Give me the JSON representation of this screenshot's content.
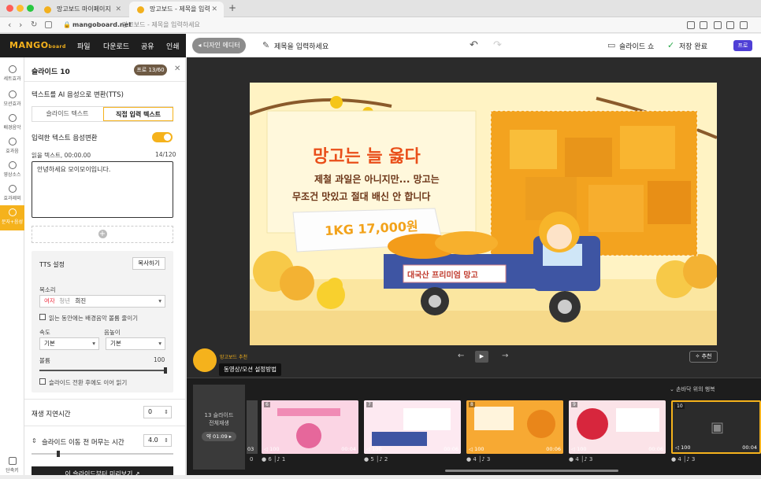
{
  "browser": {
    "tabs": [
      {
        "label": "망고보드 마이페이지"
      },
      {
        "label": "망고보드 - 제목을 입력하세요"
      }
    ],
    "url_domain": "mangoboard.net",
    "url_title": "망고보드 - 제목을 입력하세요",
    "new_tab": "+"
  },
  "header": {
    "logo": "MANGO",
    "logo_suffix": "board",
    "menus": [
      "파일",
      "다운로드",
      "공유",
      "인쇄"
    ],
    "designer_editor": "◂ 디자인 에디터",
    "title_placeholder": "제목을 입력하세요",
    "slideshow": "슬라이드 쇼",
    "saved": "저장 완료",
    "pro": "프로"
  },
  "rail": [
    {
      "label": "세트효과",
      "icon": "gear-icon"
    },
    {
      "label": "모션효과",
      "icon": "motion-icon"
    },
    {
      "label": "배경음악",
      "icon": "music-icon"
    },
    {
      "label": "효과음",
      "icon": "sound-effect-icon"
    },
    {
      "label": "영상소스",
      "icon": "video-source-icon"
    },
    {
      "label": "효과제외",
      "icon": "exclude-icon"
    },
    {
      "label": "문자+음성",
      "icon": "microphone-icon"
    }
  ],
  "rail_bottom": "단축키",
  "panel": {
    "title": "슬라이드 10",
    "badge": "프로 13/60",
    "tts_title": "텍스트를 AI 음성으로 변환(TTS)",
    "tab_slide_text": "슬라이드 텍스트",
    "tab_direct_text": "직접 입력 텍스트",
    "convert_label": "입력한 텍스트 음성변환",
    "read_label": "읽을 텍스트, 00:00.00",
    "char_count": "14/120",
    "text_value": "안녕하세요 모이모이입니다.",
    "add": "+",
    "tts_settings": "TTS 설정",
    "copy": "복사하기",
    "voice_label": "목소리",
    "voice_tag_female": "여자",
    "voice_tag_youth": "청년",
    "voice_name": "희진",
    "bgm_reduce": "읽는 동안에는 배경음악 볼륨 줄이기",
    "speed_label": "속도",
    "speed_value": "기본",
    "pitch_label": "음높이",
    "pitch_value": "기본",
    "volume_label": "볼륨",
    "volume_value": "100",
    "continue_label": "슬라이드 전환 후에도 이어 읽기",
    "delay_label": "재생 지연시간",
    "delay_value": "0",
    "dwell_label": "슬라이드 이동 전 머무는 시간",
    "dwell_value": "4.0",
    "preview_button": "이 슬라이드부터 미리보기 ↗"
  },
  "canvas": {
    "headline": "망고는 늘 옳다",
    "body_line1": "제철 과일은 아니지만... 망고는",
    "body_line2": "무조건 맛있고 절대 배신 안 합니다",
    "price": "1KG 17,000원",
    "truck_sign": "대국산 프리미엄 망고",
    "prev": "←",
    "play": "▶",
    "next": "→",
    "recommend": "추천",
    "mascot_note": "망고보드 추천",
    "tooltip": "동영상/모션 설정방법"
  },
  "timeline": {
    "hand_label": "⌄ 손바닥 위의 행복",
    "all_slides_line1": "13 슬라이드",
    "all_slides_line2": "전체재생",
    "all_slides_duration": "약 01:09 ▸",
    "thumbs": [
      {
        "num": "6",
        "vol": "◁ 100",
        "dur": "00:04",
        "meta": "● 6 │♪ 1"
      },
      {
        "num": "7",
        "vol": "◁ 100",
        "dur": "00:06",
        "meta": "● 5 │♪ 2"
      },
      {
        "num": "8",
        "vol": "◁ 100",
        "dur": "00:06",
        "meta": "● 4 │♪ 3"
      },
      {
        "num": "9",
        "vol": "◁ 100",
        "dur": "00:06",
        "meta": "● 4 │♪ 3"
      },
      {
        "num": "10",
        "vol": "◁ 100",
        "dur": "00:04",
        "meta": "● 4 │♪ 3"
      }
    ],
    "leading_meta": "0",
    "leading_dur": "03"
  }
}
